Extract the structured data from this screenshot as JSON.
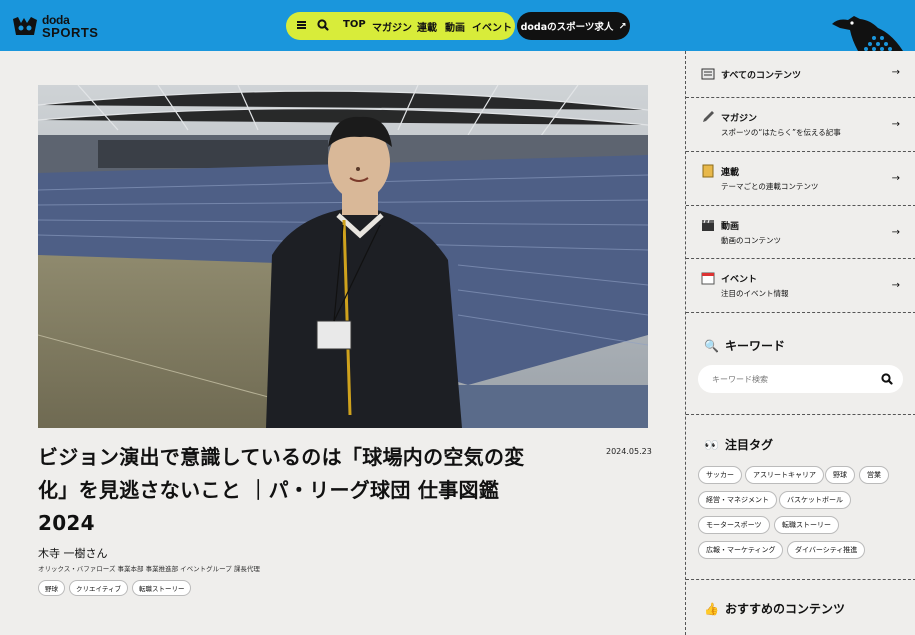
{
  "header": {
    "logo_line1": "doda",
    "logo_line2": "SPORTS",
    "nav": [
      "TOP",
      "マガジン",
      "連載",
      "動画",
      "イベント"
    ],
    "job_button": "dodaのスポーツ求人",
    "colors": {
      "bar": "#1a96dc",
      "pill": "#d8ec3a",
      "button": "#111111"
    }
  },
  "article": {
    "title": "ビジョン演出で意識しているのは「球場内の空気の変化」を見逃さないこと ｜パ・リーグ球団 仕事図鑑2024",
    "date": "2024.05.23",
    "author": "木寺 一樹さん",
    "role": "オリックス・バファローズ 事業本部 事業推進部 イベントグループ 課長代理",
    "tags": [
      "野球",
      "クリエイティブ",
      "転職ストーリー"
    ]
  },
  "sidebar": {
    "items": [
      {
        "title": "すべてのコンテンツ",
        "sub": "",
        "icon": "newspaper-icon"
      },
      {
        "title": "マガジン",
        "sub": "スポーツの“はたらく”を伝える記事",
        "icon": "pen-icon"
      },
      {
        "title": "連載",
        "sub": "テーマごとの連載コンテンツ",
        "icon": "book-icon"
      },
      {
        "title": "動画",
        "sub": "動画のコンテンツ",
        "icon": "clapper-icon"
      },
      {
        "title": "イベント",
        "sub": "注目のイベント情報",
        "icon": "calendar-icon"
      }
    ],
    "keyword_heading": "キーワード",
    "keyword_placeholder": "キーワード検索",
    "tags_heading": "注目タグ",
    "tags": [
      "サッカー",
      "アスリートキャリア",
      "野球",
      "営業",
      "経営・マネジメント",
      "バスケットボール",
      "モータースポーツ",
      "転職ストーリー",
      "広報・マーケティング",
      "ダイバーシティ推進"
    ],
    "recommend_heading": "おすすめのコンテンツ"
  }
}
